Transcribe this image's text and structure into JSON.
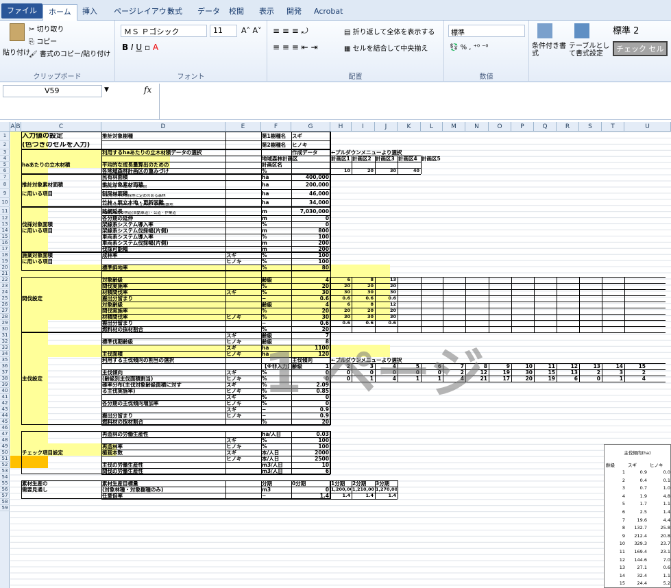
{
  "tabs": [
    "ファイル",
    "ホーム",
    "挿入",
    "ページレイアウト",
    "数式",
    "データ",
    "校閲",
    "表示",
    "開発",
    "Acrobat"
  ],
  "ribbon": {
    "paste": "貼り付け",
    "cut": "切り取り",
    "copy": "コピー",
    "format_painter": "書式のコピー/貼り付け",
    "clipboard": "クリップボード",
    "font_name": "ＭＳ Ｐゴシック",
    "font_size": "11",
    "font_group": "フォント",
    "wrap": "折り返して全体を表示する",
    "merge": "セルを結合して中央揃え",
    "align_group": "配置",
    "number_format": "標準",
    "number_group": "数値",
    "cond_format": "条件付き書式",
    "table_format": "テーブルとして書式設定",
    "style_name": "標準 2",
    "check_cell": "チェック セル"
  },
  "namebox": "V59",
  "fx": "fx",
  "columns": [
    "A",
    "B",
    "C",
    "D",
    "E",
    "F",
    "G",
    "H",
    "I",
    "J",
    "K",
    "L",
    "M",
    "N",
    "O",
    "P",
    "Q",
    "R",
    "S",
    "T",
    "U"
  ],
  "watermark": "1 ページ",
  "cells": {
    "c1": "入力値の設定",
    "c2": "(色つきのセルを入力)",
    "d1": "推計対象樹種",
    "f1": "第1樹種名",
    "g1": "スギ",
    "f2": "第2樹種名",
    "g2": "ヒノキ",
    "d3": "利用するhaあたりの立木材積データの選択",
    "g3": "作成データ",
    "h3": "←プルダウンメニューより選択",
    "c5": "haあたりの立木材積",
    "d5a": "平均的な成長量算出のための",
    "d5b": "各地域森林計画区の重みづけ",
    "f4": "地域森林計画区",
    "f5": "計画区名",
    "f6": "%",
    "p1": "計画区1",
    "p2": "計画区2",
    "p3": "計画区3",
    "p4": "計画区4",
    "p5": "計画区5",
    "v6a": "10",
    "v6b": "20",
    "v6c": "30",
    "v6d": "40",
    "c8": "推計対象素材面積",
    "c9": "に用いる項目",
    "d7": "民有林面積",
    "d8a": "推計対象素材面積",
    "d8b": "※民有林・人工林・針葉樹",
    "d9a": "制限林面積",
    "d9b": "※民有林内の伐採等に定めのある森林",
    "d10a": "竹林・無立木地・更新困難",
    "d10b": "※民有林内の竹林・無立木地・更新困難地",
    "u7": "ha",
    "u8": "ha",
    "u9": "ha",
    "u10": "ha",
    "g7": "400,000",
    "g8": "200,000",
    "g9": "46,000",
    "g10": "34,000",
    "c13": "伐採対象面積",
    "c14": "に用いる項目",
    "d11a": "路網延長",
    "d11b": "※民有林内の林道(自動車道)・公道・作業道",
    "d12": "各分期の延伸",
    "d13": "架線系システム導入率",
    "d14": "架線系システム伐採幅(片側)",
    "d15": "車両系システム導入率",
    "d16": "車両系システム伐採幅(片側)",
    "d17": "伐採可能幅",
    "u11": "m",
    "u12": "m",
    "u13": "%",
    "u14": "m",
    "u15": "%",
    "u16": "m",
    "u17": "m",
    "g11": "7,030,000",
    "g12": "0",
    "g13": "0",
    "g14": "800",
    "g15": "100",
    "g16": "200",
    "g17": "200",
    "c18": "施業対象面積",
    "c19": "に用いる項目",
    "d18": "成林率",
    "e18": "スギ",
    "e19": "ヒノキ",
    "d20": "標準斜地率",
    "u18": "%",
    "u19": "%",
    "u20": "%",
    "g18": "100",
    "g19": "100",
    "g20": "80",
    "c25": "間伐設定",
    "d22": "対象齢級",
    "d23": "間伐実施率",
    "d24": "材積間伐率",
    "d25": "搬出分留まり",
    "d26": "対象齢級",
    "d27": "間伐実施率",
    "d28": "材積間伐率",
    "d29": "搬出分留まり",
    "d30": "燃料材の採材割合",
    "e24": "スギ",
    "e28": "ヒノキ",
    "u22": "齢級",
    "u23": "%",
    "u24": "%",
    "u25": "−",
    "u26": "齢級",
    "u27": "%",
    "u28": "%",
    "u29": "−",
    "u30": "%",
    "g22": "4",
    "g23": "20",
    "g24": "30",
    "g25": "0.6",
    "g26": "4",
    "g27": "20",
    "g28": "30",
    "g29": "0.6",
    "g30": "20",
    "h22": "6",
    "h23": "20",
    "h24": "30",
    "h25": "0.6",
    "h26": "6",
    "h27": "20",
    "h28": "30",
    "h29": "0.6",
    "i22": "8",
    "i23": "20",
    "i24": "30",
    "i25": "0.6",
    "i26": "8",
    "i27": "20",
    "i28": "30",
    "i29": "0.6",
    "j22": "13",
    "j23": "20",
    "j24": "30",
    "j25": "0.6",
    "j26": "12",
    "j27": "20",
    "j28": "30",
    "j29": "0.6",
    "c38": "主伐設定",
    "d31": "標準伐期齢級",
    "d33": "主伐面積",
    "d35": "利用する主伐傾向の割当の選択",
    "g35": "主伐傾向",
    "h35": "←プルダウンメニューより選択",
    "e31": "スギ",
    "e32": "ヒノキ",
    "e33": "スギ",
    "e34": "ヒノキ",
    "u31": "齢級",
    "u32": "齢級",
    "u33": "ha",
    "u34": "ha",
    "g31": "7",
    "g32": "8",
    "g33": "1100",
    "g34": "120",
    "f36": "【※非入力】",
    "g36": "齢級",
    "d37a": "主伐傾向",
    "d37b": "(齢級別主伐面積割当)",
    "e37": "スギ",
    "e38": "ヒノキ",
    "u37": "%",
    "u38": "%",
    "d39a": "確率分布(主伐対象齢級面積に対す",
    "d39b": "る主伐実施率)",
    "e39": "スギ",
    "e40": "ヒノキ",
    "u39": "%",
    "u40": "%",
    "g39": "2.09",
    "g40": "0.85",
    "d42": "各分期の主伐傾向増加率",
    "e41": "スギ",
    "e42": "ヒノキ",
    "u41": "%",
    "u42": "%",
    "g41": "0",
    "g42": "0",
    "d44": "搬出分留まり",
    "e43": "スギ",
    "e44": "ヒノキ",
    "u43": "−",
    "u44": "−",
    "g43": "0.9",
    "g44": "0.9",
    "d45": "燃料材の採材割合",
    "u45": "%",
    "g45": "20",
    "c50": "チェック項目設定",
    "d47": "再造林の労働生産性",
    "d48": "再造林率",
    "d50": "植栽本数",
    "d52": "主伐の労働生産性",
    "d53": "間伐の労働生産性",
    "e48": "スギ",
    "e49": "ヒノキ",
    "e50": "スギ",
    "e51": "ヒノキ",
    "u47": "ha/人日",
    "u48": "%",
    "u49": "%",
    "u50": "本/人日",
    "u51": "本/人日",
    "u52": "m3/人日",
    "u53": "m3/人日",
    "g47": "0.03",
    "g48": "100",
    "g49": "100",
    "g50": "2000",
    "g51": "2500",
    "g52": "10",
    "g53": "6",
    "c55": "素材生産の",
    "c56": "需要見通し",
    "d55": "素材生産目標量",
    "d56": "(対象林種・対象樹種のみ)",
    "d57": "任意倍率",
    "f55": "分期",
    "f56": "m3",
    "f57": "−",
    "g55": "0分期",
    "h55": "1分期",
    "i55": "2分期",
    "j55": "3分期",
    "g56": "0",
    "h56": "1,200,000",
    "i56": "1,210,000",
    "j56": "1,270,000",
    "g57": "1.4",
    "h57": "1.4",
    "i57": "1.4",
    "j57": "1.4"
  },
  "row36": [
    "1",
    "2",
    "3",
    "4",
    "5",
    "6",
    "7",
    "8",
    "9",
    "10",
    "11",
    "12",
    "13",
    "14",
    "15"
  ],
  "row37": [
    "0",
    "0",
    "0",
    "0",
    "0",
    "0",
    "2",
    "12",
    "19",
    "30",
    "15",
    "13",
    "2",
    "3",
    "2"
  ],
  "row38": [
    "0",
    "0",
    "1",
    "4",
    "1",
    "1",
    "4",
    "21",
    "17",
    "20",
    "19",
    "6",
    "0",
    "1",
    "4"
  ],
  "mini": {
    "title": "主伐傾向(ha)",
    "h0": "齢級",
    "h1": "スギ",
    "h2": "ヒノキ",
    "rows": [
      [
        "1",
        "0.9",
        "0.0"
      ],
      [
        "2",
        "0.4",
        "0.1"
      ],
      [
        "3",
        "0.7",
        "1.0"
      ],
      [
        "4",
        "1.9",
        "4.8"
      ],
      [
        "5",
        "1.7",
        "1.1"
      ],
      [
        "6",
        "2.5",
        "1.4"
      ],
      [
        "7",
        "19.6",
        "4.4"
      ],
      [
        "8",
        "132.7",
        "25.8"
      ],
      [
        "9",
        "212.4",
        "20.8"
      ],
      [
        "10",
        "329.3",
        "23.7"
      ],
      [
        "11",
        "169.4",
        "23.1"
      ],
      [
        "12",
        "144.6",
        "7.0"
      ],
      [
        "13",
        "27.1",
        "0.6"
      ],
      [
        "14",
        "32.4",
        "1.1"
      ],
      [
        "15",
        "24.4",
        "5.2"
      ]
    ]
  }
}
